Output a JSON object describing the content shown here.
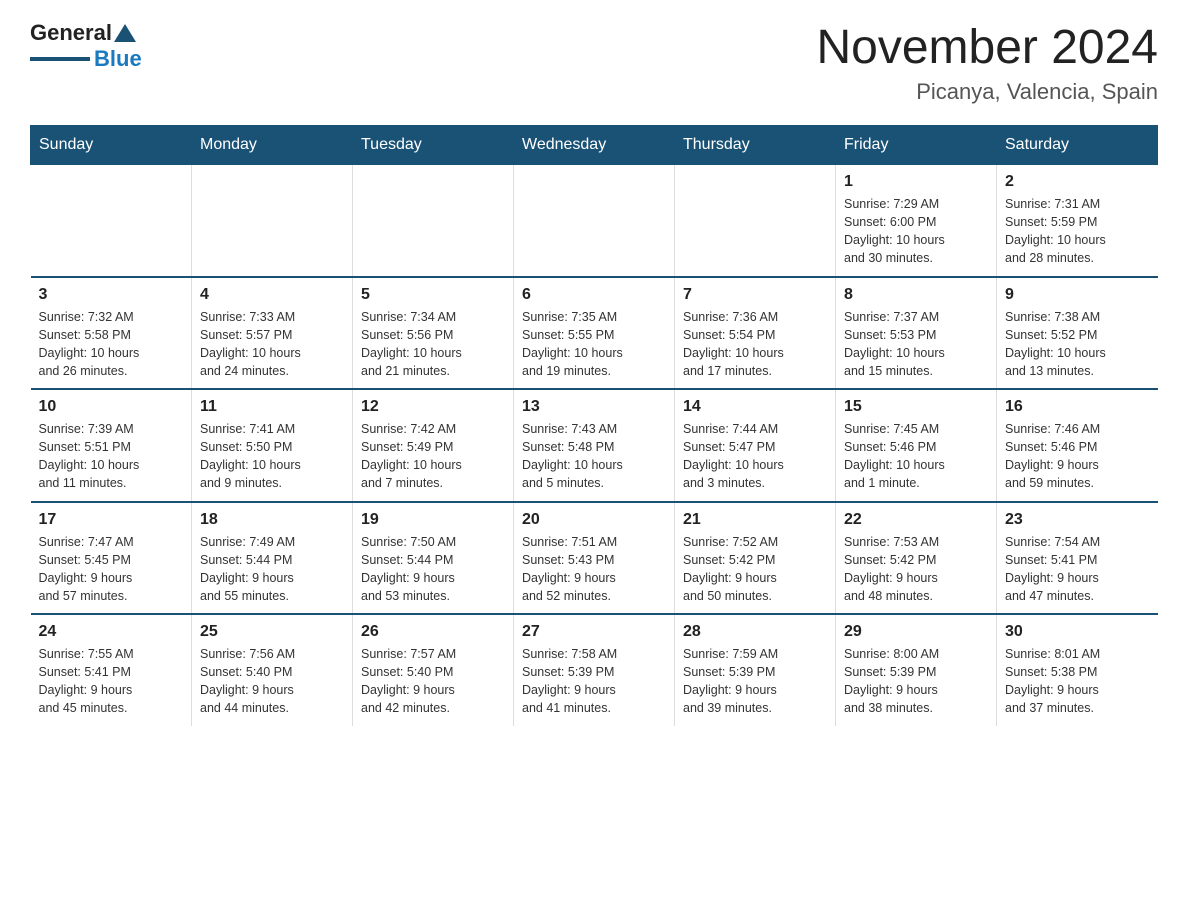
{
  "header": {
    "logo_general": "General",
    "logo_blue": "Blue",
    "title": "November 2024",
    "subtitle": "Picanya, Valencia, Spain"
  },
  "days_of_week": [
    "Sunday",
    "Monday",
    "Tuesday",
    "Wednesday",
    "Thursday",
    "Friday",
    "Saturday"
  ],
  "weeks": [
    {
      "days": [
        {
          "num": "",
          "info": ""
        },
        {
          "num": "",
          "info": ""
        },
        {
          "num": "",
          "info": ""
        },
        {
          "num": "",
          "info": ""
        },
        {
          "num": "",
          "info": ""
        },
        {
          "num": "1",
          "info": "Sunrise: 7:29 AM\nSunset: 6:00 PM\nDaylight: 10 hours\nand 30 minutes."
        },
        {
          "num": "2",
          "info": "Sunrise: 7:31 AM\nSunset: 5:59 PM\nDaylight: 10 hours\nand 28 minutes."
        }
      ]
    },
    {
      "days": [
        {
          "num": "3",
          "info": "Sunrise: 7:32 AM\nSunset: 5:58 PM\nDaylight: 10 hours\nand 26 minutes."
        },
        {
          "num": "4",
          "info": "Sunrise: 7:33 AM\nSunset: 5:57 PM\nDaylight: 10 hours\nand 24 minutes."
        },
        {
          "num": "5",
          "info": "Sunrise: 7:34 AM\nSunset: 5:56 PM\nDaylight: 10 hours\nand 21 minutes."
        },
        {
          "num": "6",
          "info": "Sunrise: 7:35 AM\nSunset: 5:55 PM\nDaylight: 10 hours\nand 19 minutes."
        },
        {
          "num": "7",
          "info": "Sunrise: 7:36 AM\nSunset: 5:54 PM\nDaylight: 10 hours\nand 17 minutes."
        },
        {
          "num": "8",
          "info": "Sunrise: 7:37 AM\nSunset: 5:53 PM\nDaylight: 10 hours\nand 15 minutes."
        },
        {
          "num": "9",
          "info": "Sunrise: 7:38 AM\nSunset: 5:52 PM\nDaylight: 10 hours\nand 13 minutes."
        }
      ]
    },
    {
      "days": [
        {
          "num": "10",
          "info": "Sunrise: 7:39 AM\nSunset: 5:51 PM\nDaylight: 10 hours\nand 11 minutes."
        },
        {
          "num": "11",
          "info": "Sunrise: 7:41 AM\nSunset: 5:50 PM\nDaylight: 10 hours\nand 9 minutes."
        },
        {
          "num": "12",
          "info": "Sunrise: 7:42 AM\nSunset: 5:49 PM\nDaylight: 10 hours\nand 7 minutes."
        },
        {
          "num": "13",
          "info": "Sunrise: 7:43 AM\nSunset: 5:48 PM\nDaylight: 10 hours\nand 5 minutes."
        },
        {
          "num": "14",
          "info": "Sunrise: 7:44 AM\nSunset: 5:47 PM\nDaylight: 10 hours\nand 3 minutes."
        },
        {
          "num": "15",
          "info": "Sunrise: 7:45 AM\nSunset: 5:46 PM\nDaylight: 10 hours\nand 1 minute."
        },
        {
          "num": "16",
          "info": "Sunrise: 7:46 AM\nSunset: 5:46 PM\nDaylight: 9 hours\nand 59 minutes."
        }
      ]
    },
    {
      "days": [
        {
          "num": "17",
          "info": "Sunrise: 7:47 AM\nSunset: 5:45 PM\nDaylight: 9 hours\nand 57 minutes."
        },
        {
          "num": "18",
          "info": "Sunrise: 7:49 AM\nSunset: 5:44 PM\nDaylight: 9 hours\nand 55 minutes."
        },
        {
          "num": "19",
          "info": "Sunrise: 7:50 AM\nSunset: 5:44 PM\nDaylight: 9 hours\nand 53 minutes."
        },
        {
          "num": "20",
          "info": "Sunrise: 7:51 AM\nSunset: 5:43 PM\nDaylight: 9 hours\nand 52 minutes."
        },
        {
          "num": "21",
          "info": "Sunrise: 7:52 AM\nSunset: 5:42 PM\nDaylight: 9 hours\nand 50 minutes."
        },
        {
          "num": "22",
          "info": "Sunrise: 7:53 AM\nSunset: 5:42 PM\nDaylight: 9 hours\nand 48 minutes."
        },
        {
          "num": "23",
          "info": "Sunrise: 7:54 AM\nSunset: 5:41 PM\nDaylight: 9 hours\nand 47 minutes."
        }
      ]
    },
    {
      "days": [
        {
          "num": "24",
          "info": "Sunrise: 7:55 AM\nSunset: 5:41 PM\nDaylight: 9 hours\nand 45 minutes."
        },
        {
          "num": "25",
          "info": "Sunrise: 7:56 AM\nSunset: 5:40 PM\nDaylight: 9 hours\nand 44 minutes."
        },
        {
          "num": "26",
          "info": "Sunrise: 7:57 AM\nSunset: 5:40 PM\nDaylight: 9 hours\nand 42 minutes."
        },
        {
          "num": "27",
          "info": "Sunrise: 7:58 AM\nSunset: 5:39 PM\nDaylight: 9 hours\nand 41 minutes."
        },
        {
          "num": "28",
          "info": "Sunrise: 7:59 AM\nSunset: 5:39 PM\nDaylight: 9 hours\nand 39 minutes."
        },
        {
          "num": "29",
          "info": "Sunrise: 8:00 AM\nSunset: 5:39 PM\nDaylight: 9 hours\nand 38 minutes."
        },
        {
          "num": "30",
          "info": "Sunrise: 8:01 AM\nSunset: 5:38 PM\nDaylight: 9 hours\nand 37 minutes."
        }
      ]
    }
  ]
}
